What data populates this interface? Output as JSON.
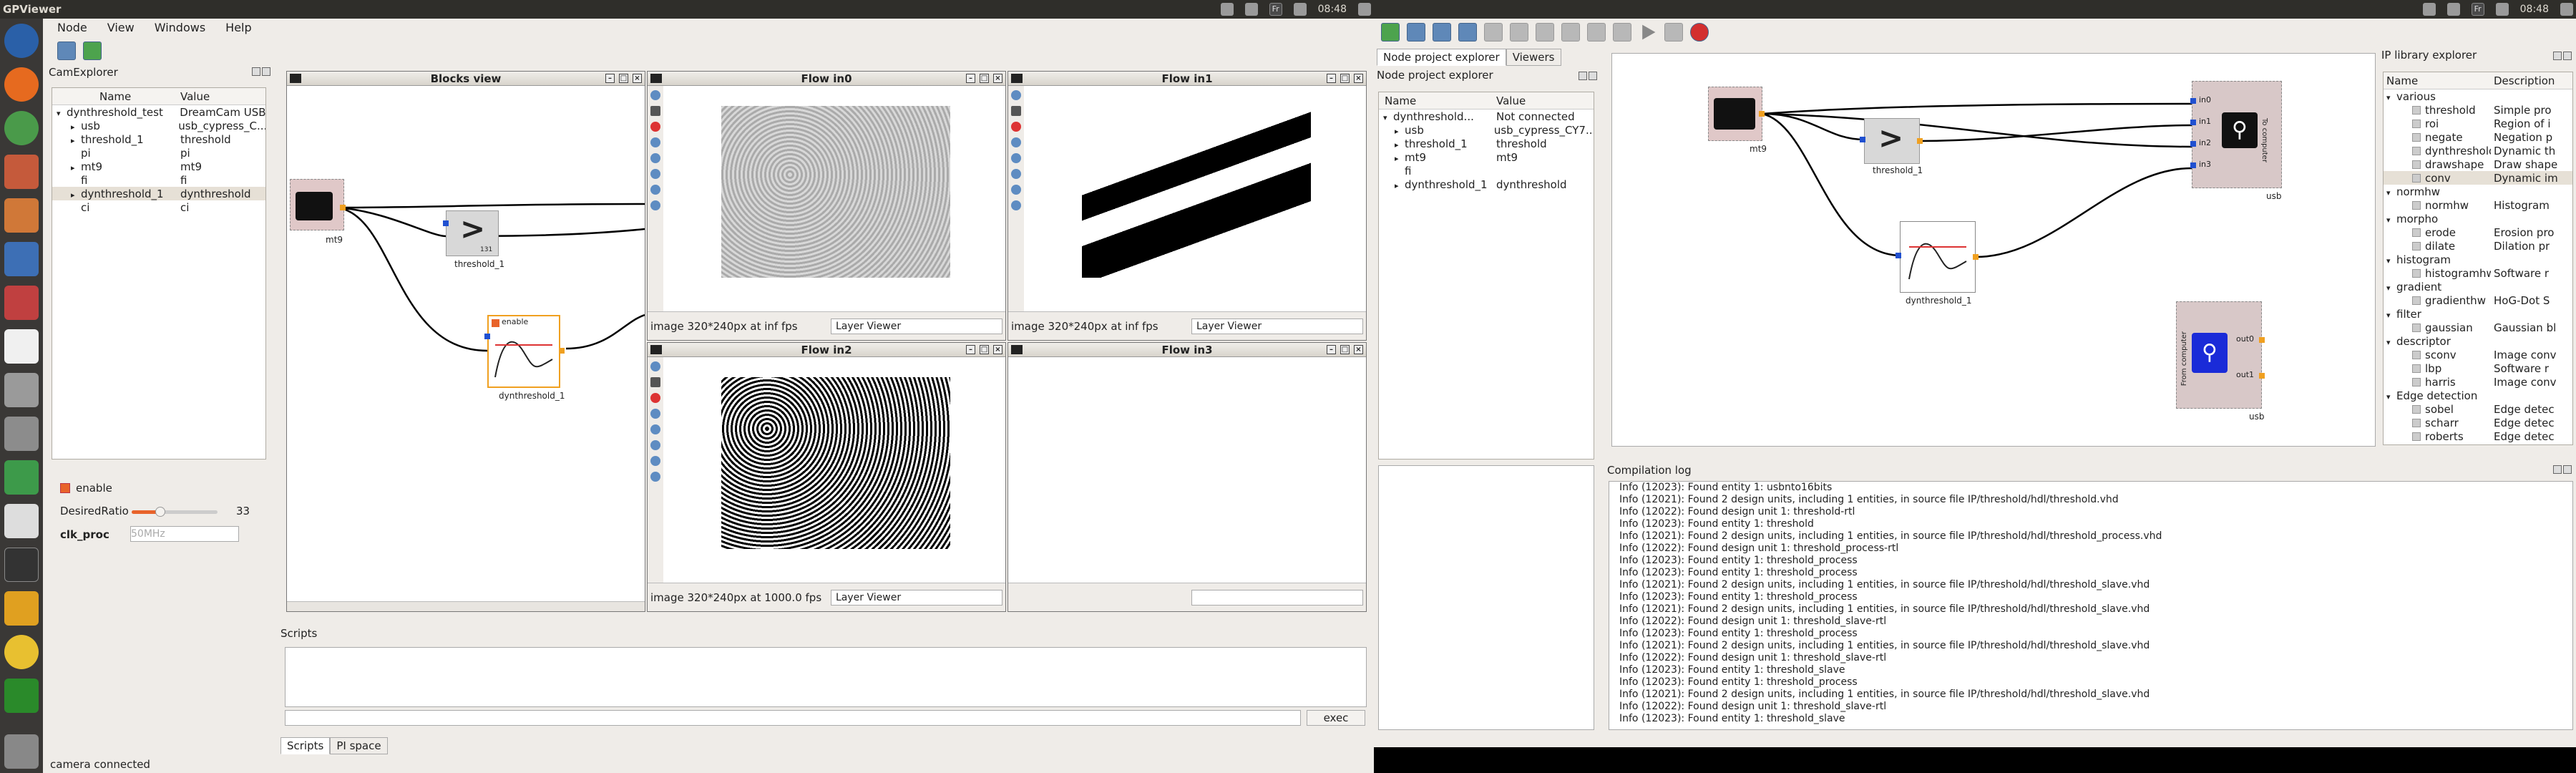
{
  "left_app": {
    "title": "GPViewer",
    "menu": [
      "Node",
      "View",
      "Windows",
      "Help"
    ],
    "time": "08:48",
    "tray_fr": "Fr",
    "cam_explorer": {
      "title": "CamExplorer",
      "headers": [
        "Name",
        "Value"
      ],
      "rows": [
        {
          "name": "dynthreshold_test",
          "value": "DreamCam USB",
          "indent": 0,
          "arrow": "▾"
        },
        {
          "name": "usb",
          "value": "usb_cypress_C...",
          "indent": 1,
          "arrow": "▸"
        },
        {
          "name": "threshold_1",
          "value": "threshold",
          "indent": 1,
          "arrow": "▸"
        },
        {
          "name": "pi",
          "value": "pi",
          "indent": 1,
          "arrow": ""
        },
        {
          "name": "mt9",
          "value": "mt9",
          "indent": 1,
          "arrow": "▸"
        },
        {
          "name": "fi",
          "value": "fi",
          "indent": 1,
          "arrow": ""
        },
        {
          "name": "dynthreshold_1",
          "value": "dynthreshold",
          "indent": 1,
          "arrow": "▸",
          "selected": true
        },
        {
          "name": "ci",
          "value": "ci",
          "indent": 1,
          "arrow": ""
        }
      ]
    },
    "properties": {
      "enable_label": "enable",
      "desired_ratio_label": "DesiredRatio",
      "desired_ratio_value": "33",
      "desired_ratio_fraction": 0.33,
      "clk_label": "clk_proc",
      "clk_value": "50MHz"
    },
    "blocks_view": {
      "title": "Blocks view",
      "nodes": {
        "mt9": "mt9",
        "threshold": "threshold_1",
        "threshold_value": "131",
        "dynthreshold": "dynthreshold_1",
        "dyn_enable": "enable"
      }
    },
    "flows": [
      {
        "title": "Flow in0",
        "status": "image 320*240px at inf fps",
        "viewer": "Layer Viewer"
      },
      {
        "title": "Flow in1",
        "status": "image 320*240px at inf fps",
        "viewer": "Layer Viewer"
      },
      {
        "title": "Flow in2",
        "status": "image 320*240px at 1000.0 fps",
        "viewer": "Layer Viewer"
      },
      {
        "title": "Flow in3",
        "status": "",
        "viewer": ""
      }
    ],
    "scripts": {
      "title": "Scripts",
      "exec_label": "exec",
      "tabs": [
        "Scripts",
        "PI space"
      ]
    },
    "status": "camera connected"
  },
  "right_app": {
    "time": "08:48",
    "tray_fr": "Fr",
    "tabs": [
      "Node project explorer",
      "Viewers"
    ],
    "node_explorer": {
      "title": "Node project explorer",
      "headers": [
        "Name",
        "Value"
      ],
      "rows": [
        {
          "name": "dynthreshold...",
          "value": "Not connected",
          "indent": 0,
          "arrow": "▾"
        },
        {
          "name": "usb",
          "value": "usb_cypress_CY7...",
          "indent": 1,
          "arrow": "▸"
        },
        {
          "name": "threshold_1",
          "value": "threshold",
          "indent": 1,
          "arrow": "▸"
        },
        {
          "name": "mt9",
          "value": "mt9",
          "indent": 1,
          "arrow": "▸"
        },
        {
          "name": "fi",
          "value": "",
          "indent": 1,
          "arrow": ""
        },
        {
          "name": "dynthreshold_1",
          "value": "dynthreshold",
          "indent": 1,
          "arrow": "▸"
        }
      ]
    },
    "graph": {
      "mt9": "mt9",
      "threshold": "threshold_1",
      "dynthreshold": "dynthreshold_1",
      "usb_top": "usb",
      "usb_top_side": "To computer",
      "usb_top_ports": [
        "in0",
        "in1",
        "in2",
        "in3"
      ],
      "usb_bottom": "usb",
      "usb_bottom_side": "From computer",
      "usb_bottom_ports": [
        "out0",
        "out1"
      ]
    },
    "ip_library": {
      "title": "IP library explorer",
      "headers": [
        "Name",
        "Description"
      ],
      "rows": [
        {
          "name": "various",
          "desc": "",
          "cat": true
        },
        {
          "name": "threshold",
          "desc": "Simple pro"
        },
        {
          "name": "roi",
          "desc": "Region of i"
        },
        {
          "name": "negate",
          "desc": "Negation p"
        },
        {
          "name": "dynthreshold",
          "desc": "Dynamic th"
        },
        {
          "name": "drawshape",
          "desc": "Draw shape"
        },
        {
          "name": "conv",
          "desc": "Dynamic im",
          "selected": true
        },
        {
          "name": "normhw",
          "desc": "",
          "cat": true
        },
        {
          "name": "normhw",
          "desc": "Histogram"
        },
        {
          "name": "morpho",
          "desc": "",
          "cat": true
        },
        {
          "name": "erode",
          "desc": "Erosion pro"
        },
        {
          "name": "dilate",
          "desc": "Dilation pr"
        },
        {
          "name": "histogram",
          "desc": "",
          "cat": true
        },
        {
          "name": "histogramhw",
          "desc": "Software r"
        },
        {
          "name": "gradient",
          "desc": "",
          "cat": true
        },
        {
          "name": "gradienthw",
          "desc": "HoG-Dot S"
        },
        {
          "name": "filter",
          "desc": "",
          "cat": true
        },
        {
          "name": "gaussian",
          "desc": "Gaussian bl"
        },
        {
          "name": "descriptor",
          "desc": "",
          "cat": true
        },
        {
          "name": "sconv",
          "desc": "Image conv"
        },
        {
          "name": "lbp",
          "desc": "Software r"
        },
        {
          "name": "harris",
          "desc": "Image conv"
        },
        {
          "name": "Edge detection",
          "desc": "",
          "cat": true
        },
        {
          "name": "sobel",
          "desc": "Edge detec"
        },
        {
          "name": "scharr",
          "desc": "Edge detec"
        },
        {
          "name": "roberts",
          "desc": "Edge detec"
        }
      ]
    },
    "compilation_log": {
      "title": "Compilation log",
      "lines": [
        "Info (12023): Found entity 1: usbnto16bits",
        "Info (12021): Found 2 design units, including 1 entities, in source file IP/threshold/hdl/threshold.vhd",
        "Info (12022): Found design unit 1: threshold-rtl",
        "Info (12023): Found entity 1: threshold",
        "Info (12021): Found 2 design units, including 1 entities, in source file IP/threshold/hdl/threshold_process.vhd",
        "Info (12022): Found design unit 1: threshold_process-rtl",
        "Info (12023): Found entity 1: threshold_process",
        "Info (12023): Found entity 1: threshold_process",
        "Info (12021): Found 2 design units, including 1 entities, in source file IP/threshold/hdl/threshold_slave.vhd",
        "Info (12023): Found entity 1: threshold_process",
        "Info (12021): Found 2 design units, including 1 entities, in source file IP/threshold/hdl/threshold_slave.vhd",
        "Info (12022): Found design unit 1: threshold_slave-rtl",
        "Info (12023): Found entity 1: threshold_process",
        "Info (12021): Found 2 design units, including 1 entities, in source file IP/threshold/hdl/threshold_slave.vhd",
        "Info (12022): Found design unit 1: threshold_slave-rtl",
        "Info (12023): Found entity 1: threshold_slave",
        "Info (12023): Found entity 1: threshold_process",
        "Info (12021): Found 2 design units, including 1 entities, in source file IP/threshold/hdl/threshold_slave.vhd",
        "Info (12022): Found design unit 1: threshold_slave-rtl",
        "Info (12023): Found entity 1: threshold_slave"
      ]
    }
  }
}
